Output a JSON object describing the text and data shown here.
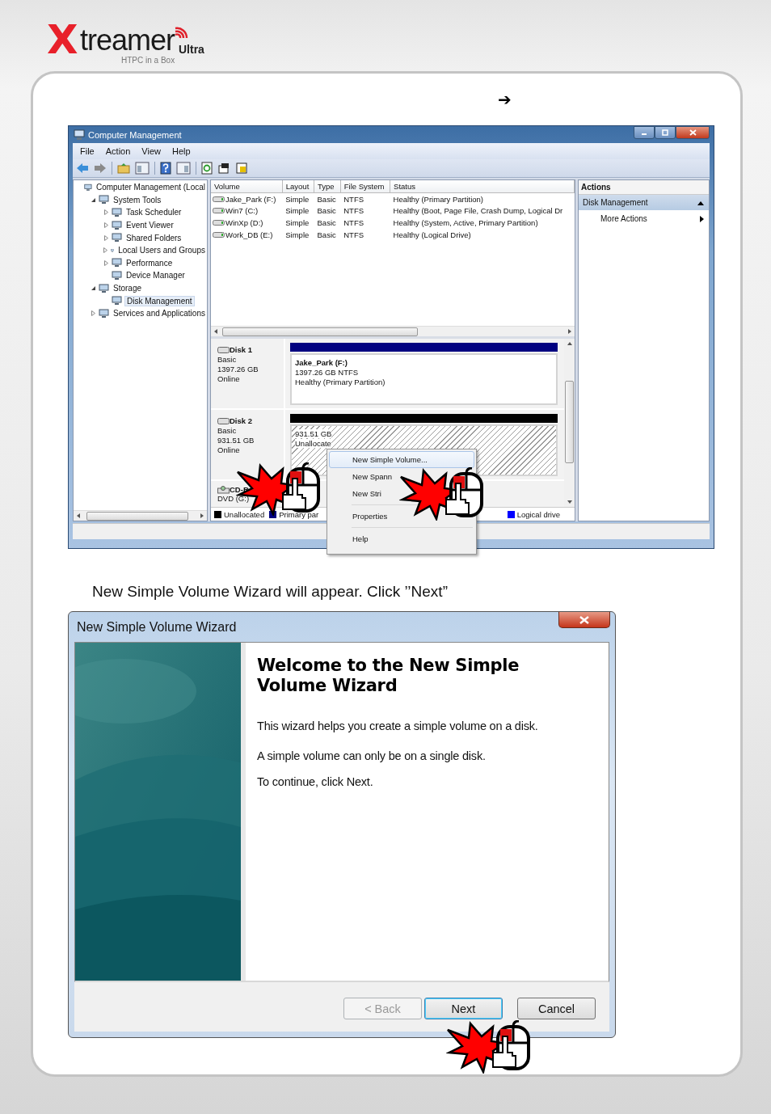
{
  "logo": {
    "mark": "X",
    "name": "treamer",
    "edition": "Ultra",
    "tagline": "HTPC in a Box"
  },
  "step_arrow": "➔",
  "computer_management": {
    "title": "Computer Management",
    "menu": [
      "File",
      "Action",
      "View",
      "Help"
    ],
    "tree": [
      {
        "label": "Computer Management (Local",
        "selected": false,
        "children": [
          {
            "label": "System Tools",
            "selected": false,
            "expanded": true,
            "children": [
              {
                "label": "Task Scheduler",
                "selected": false,
                "expanded": false
              },
              {
                "label": "Event Viewer",
                "selected": false,
                "expanded": false
              },
              {
                "label": "Shared Folders",
                "selected": false,
                "expanded": false
              },
              {
                "label": "Local Users and Groups",
                "selected": false,
                "expanded": false
              },
              {
                "label": "Performance",
                "selected": false,
                "expanded": false
              },
              {
                "label": "Device Manager",
                "selected": false
              }
            ]
          },
          {
            "label": "Storage",
            "selected": false,
            "expanded": true,
            "children": [
              {
                "label": "Disk Management",
                "selected": true
              }
            ]
          },
          {
            "label": "Services and Applications",
            "selected": false,
            "expanded": false
          }
        ]
      }
    ],
    "volume_table": {
      "columns": [
        "Volume",
        "Layout",
        "Type",
        "File System",
        "Status"
      ],
      "rows": [
        [
          "Jake_Park (F:)",
          "Simple",
          "Basic",
          "NTFS",
          "Healthy (Primary Partition)"
        ],
        [
          "Win7 (C:)",
          "Simple",
          "Basic",
          "NTFS",
          "Healthy (Boot, Page File, Crash Dump, Logical Dr"
        ],
        [
          "WinXp (D:)",
          "Simple",
          "Basic",
          "NTFS",
          "Healthy (System, Active, Primary Partition)"
        ],
        [
          "Work_DB (E:)",
          "Simple",
          "Basic",
          "NTFS",
          "Healthy (Logical Drive)"
        ]
      ]
    },
    "disks": [
      {
        "name": "Disk 1",
        "type": "Basic",
        "size": "1397.26 GB",
        "status": "Online",
        "partition": {
          "kind": "volume",
          "color": "#000080",
          "label": "Jake_Park  (F:)",
          "detail": "1397.26 GB NTFS",
          "status": "Healthy (Primary Partition)"
        }
      },
      {
        "name": "Disk 2",
        "type": "Basic",
        "size": "931.51 GB",
        "status": "Online",
        "partition": {
          "kind": "unallocated",
          "color": "#000000",
          "label": "931.51 GB",
          "detail": "Unallocate"
        }
      }
    ],
    "cdrom": {
      "name": "CD-R",
      "type": "DVD (G:)"
    },
    "legend": [
      {
        "label": "Unallocated",
        "color": "#000000"
      },
      {
        "label": "Primary par",
        "color": "#000080"
      },
      {
        "label": "Logical drive",
        "color": "#0000ff"
      }
    ],
    "actions": {
      "title": "Actions",
      "section": "Disk Management",
      "items": [
        "More Actions"
      ]
    },
    "context_menu": [
      {
        "kind": "item",
        "label": "New Simple Volume...",
        "selected": true
      },
      {
        "kind": "item",
        "label": "New Spann",
        "selected": false
      },
      {
        "kind": "item",
        "label": "New Stri",
        "selected": false
      },
      {
        "kind": "separator"
      },
      {
        "kind": "item",
        "label": "Properties",
        "selected": false
      },
      {
        "kind": "separator"
      },
      {
        "kind": "item",
        "label": "Help",
        "selected": false
      }
    ]
  },
  "caption": "New Simple Volume Wizard will appear. Click ’’Next”",
  "wizard": {
    "title": "New Simple Volume Wizard",
    "heading": "Welcome to the New Simple Volume Wizard",
    "paragraphs": [
      "This wizard helps you create a simple volume on a disk.",
      "A simple volume can only be on a single disk.",
      "To continue, click Next."
    ],
    "buttons": [
      {
        "label": "< Back",
        "disabled": true,
        "default": false
      },
      {
        "label": "Next",
        "disabled": false,
        "default": true
      },
      {
        "label": "Cancel",
        "disabled": false,
        "default": false
      }
    ]
  }
}
